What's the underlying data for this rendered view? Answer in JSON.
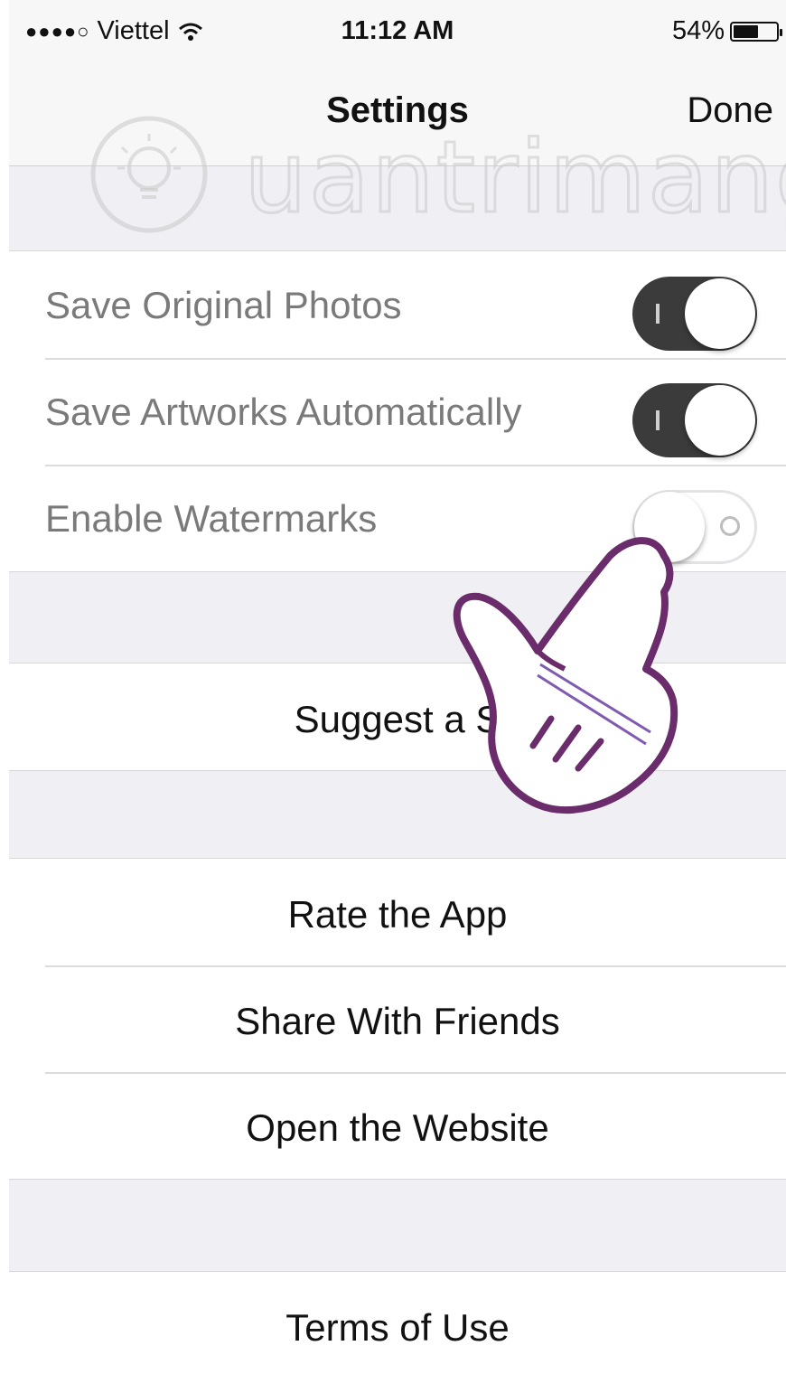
{
  "status_bar": {
    "carrier": "Viettel",
    "signal_dots": "●●●●○",
    "time": "11:12 AM",
    "battery_percent": "54%",
    "battery_level": 0.54
  },
  "nav": {
    "title": "Settings",
    "done_label": "Done"
  },
  "watermark": {
    "text": "uantrimang"
  },
  "toggles": [
    {
      "label": "Save Original Photos",
      "on": true
    },
    {
      "label": "Save Artworks Automatically",
      "on": true
    },
    {
      "label": "Enable Watermarks",
      "on": false
    }
  ],
  "suggest": {
    "label": "Suggest a S"
  },
  "links": [
    {
      "label": "Rate the App"
    },
    {
      "label": "Share With Friends"
    },
    {
      "label": "Open the Website"
    }
  ],
  "legal": {
    "label": "Terms of Use"
  }
}
